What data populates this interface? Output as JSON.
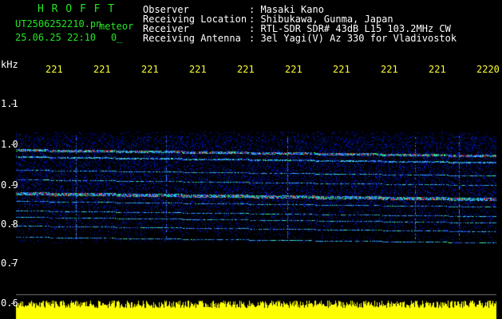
{
  "header": {
    "logo_text": "H R O F F T",
    "file_name": "UT2506252210.pn",
    "file_type": "meteor",
    "date_time": "25.06.25 22:10",
    "extra": "0_"
  },
  "info": {
    "labels": [
      "Observer",
      "Receiving Location",
      "Receiver",
      "Receiving Antenna"
    ],
    "values": [
      ": Masaki Kano",
      ": Shibukawa, Gunma, Japan",
      ": RTL-SDR SDR# 43dB L15 103.2MHz CW",
      ": 3el Yagi(V) Az 330 for Vladivostok"
    ]
  },
  "waterfall": {
    "unit_label": "kHz",
    "time_ticks": [
      "221",
      "221",
      "221",
      "221",
      "221",
      "221",
      "221",
      "221",
      "221",
      "2220"
    ],
    "freq_ticks": [
      "1.1",
      "1.0",
      "0.9",
      "0.8",
      "0.7",
      "0.6"
    ],
    "colors": {
      "background": "#000000",
      "text_green": "#22e622",
      "text_yellow": "#ffff33",
      "signal_yellow": "#ffff00"
    }
  }
}
